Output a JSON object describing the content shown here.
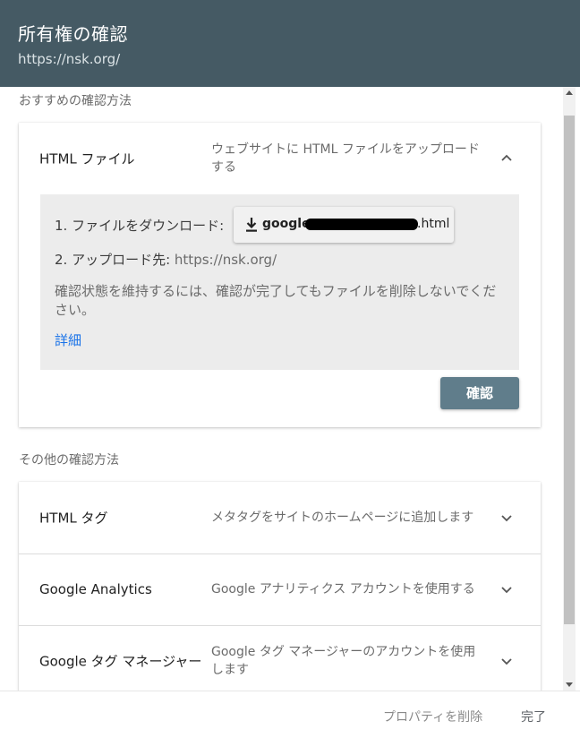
{
  "header": {
    "title": "所有権の確認",
    "url": "https://nsk.org/"
  },
  "recommended": {
    "section_label": "おすすめの確認方法",
    "method": "HTML ファイル",
    "description": "ウェブサイトに HTML ファイルをアップロードする",
    "expanded": true,
    "step1_label": "1. ファイルをダウンロード:",
    "download": {
      "icon": "download-icon",
      "filename_prefix": "google",
      "filename_suffix": ".html"
    },
    "step2_label": "2. アップロード先:",
    "step2_url": "https://nsk.org/",
    "note": "確認状態を維持するには、確認が完了してもファイルを削除しないでください。",
    "more_link": "詳細",
    "verify_button": "確認"
  },
  "other": {
    "section_label": "その他の確認方法",
    "methods": [
      {
        "name": "HTML タグ",
        "description": "メタタグをサイトのホームページに追加します"
      },
      {
        "name": "Google Analytics",
        "description": "Google アナリティクス アカウントを使用する"
      },
      {
        "name": "Google タグ マネージャー",
        "description": "Google タグ マネージャーのアカウントを使用します"
      }
    ]
  },
  "footer": {
    "delete_label": "プロパティを削除",
    "done_label": "完了"
  },
  "colors": {
    "header_bg": "#455a64",
    "primary_button": "#607d8b",
    "link": "#1a73e8"
  }
}
